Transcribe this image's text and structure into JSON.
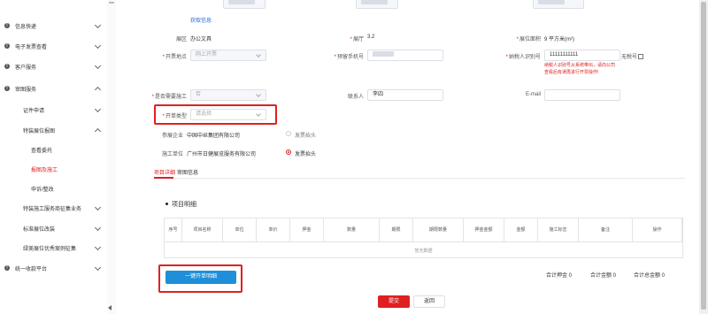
{
  "sidebar": {
    "items": [
      {
        "label": "信息快递",
        "icon": "info-icon",
        "expanded": false
      },
      {
        "label": "电子发票查看",
        "icon": "info-icon",
        "expanded": false
      },
      {
        "label": "客户服务",
        "icon": "info-icon",
        "expanded": false
      },
      {
        "label": "审图服务",
        "icon": "info-icon",
        "expanded": true
      },
      {
        "label": "证件申请",
        "expanded": false
      },
      {
        "label": "特装展位报图",
        "expanded": true
      },
      {
        "label": "查看委托"
      },
      {
        "label": "报图及施工",
        "active": true
      },
      {
        "label": "申诉/整改"
      },
      {
        "label": "特装施工服务商征集业务",
        "expanded": false
      },
      {
        "label": "标准展位改装",
        "expanded": false
      },
      {
        "label": "绿美展位优秀案例征集",
        "expanded": false
      },
      {
        "label": "统一收款平台",
        "icon": "info-icon",
        "expanded": false
      }
    ]
  },
  "form": {
    "top_link": "获取信息",
    "area_label": "展区",
    "area_value": "办公文具",
    "hall_label": "展厅",
    "hall_value": "3.2",
    "booth_area_label": "展位面积",
    "booth_area_value": "9 平方米(m²)",
    "invoice_location_label": "开票地点",
    "invoice_location_value": "网上开票",
    "phone_label": "预留手机号",
    "tax_id_label": "纳税人识别号",
    "tax_id_value": "11111111111",
    "no_tax_label": "无税号",
    "tax_error": "纳税人识别号从系统带出，请向公司查看后有误再进行开票操作!",
    "construction_label": "是否需要施工",
    "construction_value": "否",
    "contact_label": "联系人",
    "contact_value": "李四",
    "email_label": "E-mail",
    "invoice_type_label": "开单类型",
    "invoice_type_placeholder": "请选择",
    "exhibitor_label": "参展企业",
    "exhibitor_value": "中国中丝集团有限公司",
    "exhibitor_radio": "发票抬头",
    "contractor_label": "施工单位",
    "contractor_value": "广州市日健展览服务有限公司",
    "contractor_radio": "发票抬头"
  },
  "tabs": [
    {
      "label": "项目详细",
      "active": true
    },
    {
      "label": "审图信息",
      "active": false
    }
  ],
  "details": {
    "title": "项目明细",
    "columns": [
      "序号",
      "项目名称",
      "单位",
      "单价",
      "押金",
      "数量",
      "期限",
      "期限数量",
      "押金金额",
      "金额",
      "施工标志",
      "备注",
      "操作"
    ],
    "empty_text": "暂无数据"
  },
  "actions": {
    "one_click_label": "一键开单明细",
    "deposit_total": "合计押金 0",
    "amount_total": "合计金额 0",
    "grand_total": "合计总金额 0",
    "submit_label": "提交",
    "back_label": "返回"
  },
  "colors": {
    "accent_red": "#e02020",
    "primary_blue": "#1e8fd8",
    "link_blue": "#2c6fcf"
  }
}
